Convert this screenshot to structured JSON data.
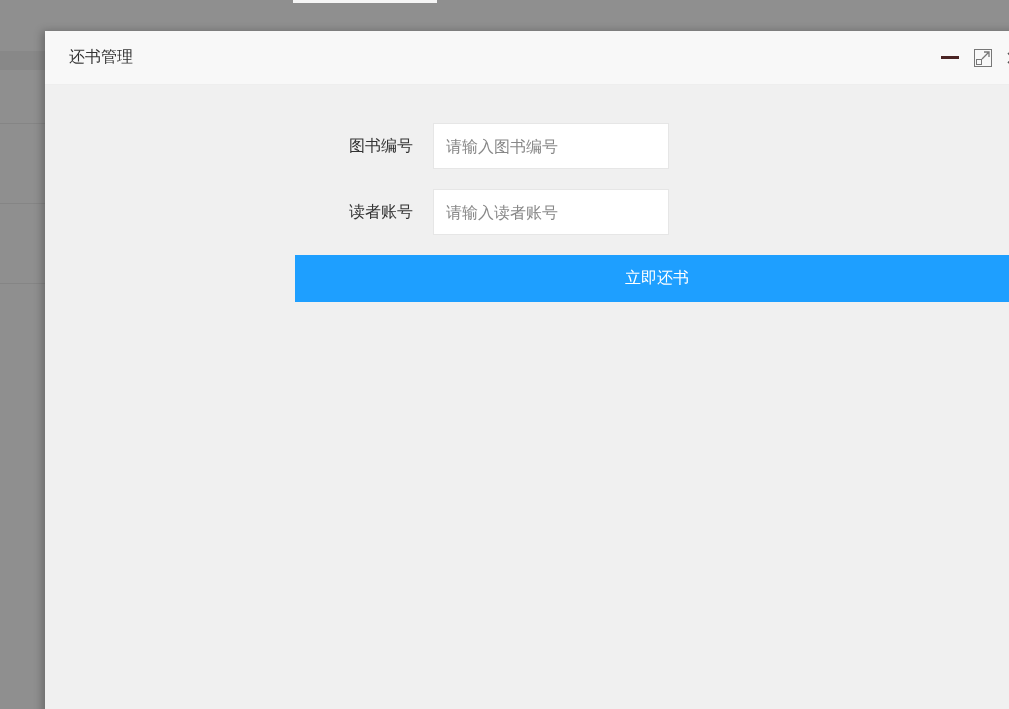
{
  "dialog": {
    "title": "还书管理"
  },
  "fields": [
    {
      "label": "图书编号",
      "placeholder": "请输入图书编号"
    },
    {
      "label": "读者账号",
      "placeholder": "请输入读者账号"
    }
  ],
  "submit_button": "立即还书"
}
